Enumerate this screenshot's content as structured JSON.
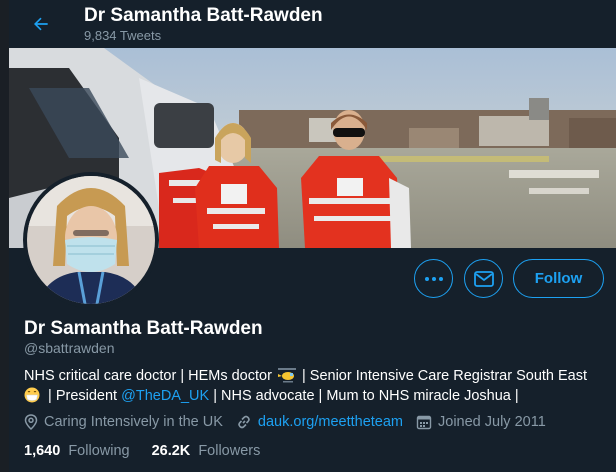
{
  "header": {
    "display_name": "Dr Samantha Batt-Rawden",
    "tweet_count": "9,834 Tweets"
  },
  "profile": {
    "display_name": "Dr Samantha Batt-Rawden",
    "handle": "@sbattrawden",
    "bio": {
      "part1": "NHS critical care doctor | HEMs doctor",
      "part2": "| Senior Intensive Care Registrar South East",
      "part3": "| President",
      "mention": "@TheDA_UK",
      "part4": "| NHS advocate | Mum to NHS miracle Joshua |"
    },
    "location": "Caring Intensively in the UK",
    "website": "dauk.org/meettheteam",
    "joined": "Joined July 2011",
    "following_count": "1,640",
    "following_label": "Following",
    "followers_count": "26.2K",
    "followers_label": "Followers"
  },
  "actions": {
    "follow_label": "Follow",
    "more_icon": "more-icon",
    "message_icon": "envelope-icon"
  },
  "colors": {
    "background": "#15202b",
    "accent": "#1da1f2",
    "secondary_text": "#8899a6"
  }
}
